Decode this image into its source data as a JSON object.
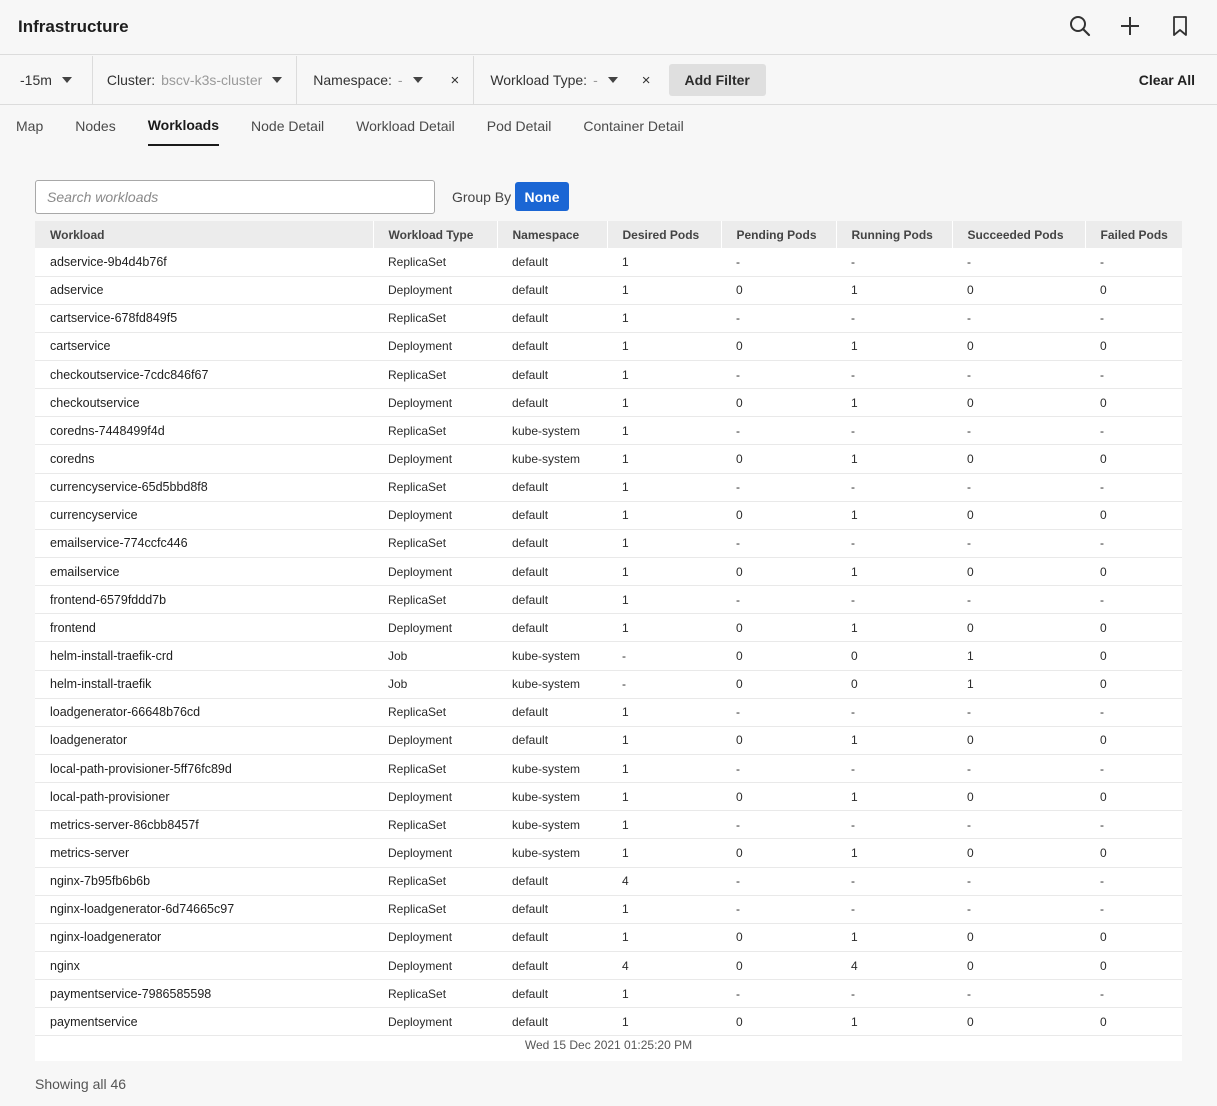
{
  "app": {
    "title": "Infrastructure"
  },
  "filters": {
    "time": "-15m",
    "cluster_label": "Cluster:",
    "cluster_value": "bscv-k3s-cluster",
    "namespace_label": "Namespace:",
    "namespace_value": "-",
    "workload_type_label": "Workload Type:",
    "workload_type_value": "-",
    "close_glyph": "×",
    "add_filter": "Add Filter",
    "clear_all": "Clear All"
  },
  "tabs": [
    {
      "label": "Map"
    },
    {
      "label": "Nodes"
    },
    {
      "label": "Workloads"
    },
    {
      "label": "Node Detail"
    },
    {
      "label": "Workload Detail"
    },
    {
      "label": "Pod Detail"
    },
    {
      "label": "Container Detail"
    }
  ],
  "search": {
    "placeholder": "Search workloads"
  },
  "group_by": {
    "label": "Group By",
    "value": "None"
  },
  "table": {
    "columns": [
      "Workload",
      "Workload Type",
      "Namespace",
      "Desired Pods",
      "Pending Pods",
      "Running Pods",
      "Succeeded Pods",
      "Failed Pods"
    ],
    "rows": [
      [
        "adservice-9b4d4b76f",
        "ReplicaSet",
        "default",
        "1",
        "-",
        "-",
        "-",
        "-"
      ],
      [
        "adservice",
        "Deployment",
        "default",
        "1",
        "0",
        "1",
        "0",
        "0"
      ],
      [
        "cartservice-678fd849f5",
        "ReplicaSet",
        "default",
        "1",
        "-",
        "-",
        "-",
        "-"
      ],
      [
        "cartservice",
        "Deployment",
        "default",
        "1",
        "0",
        "1",
        "0",
        "0"
      ],
      [
        "checkoutservice-7cdc846f67",
        "ReplicaSet",
        "default",
        "1",
        "-",
        "-",
        "-",
        "-"
      ],
      [
        "checkoutservice",
        "Deployment",
        "default",
        "1",
        "0",
        "1",
        "0",
        "0"
      ],
      [
        "coredns-7448499f4d",
        "ReplicaSet",
        "kube-system",
        "1",
        "-",
        "-",
        "-",
        "-"
      ],
      [
        "coredns",
        "Deployment",
        "kube-system",
        "1",
        "0",
        "1",
        "0",
        "0"
      ],
      [
        "currencyservice-65d5bbd8f8",
        "ReplicaSet",
        "default",
        "1",
        "-",
        "-",
        "-",
        "-"
      ],
      [
        "currencyservice",
        "Deployment",
        "default",
        "1",
        "0",
        "1",
        "0",
        "0"
      ],
      [
        "emailservice-774ccfc446",
        "ReplicaSet",
        "default",
        "1",
        "-",
        "-",
        "-",
        "-"
      ],
      [
        "emailservice",
        "Deployment",
        "default",
        "1",
        "0",
        "1",
        "0",
        "0"
      ],
      [
        "frontend-6579fddd7b",
        "ReplicaSet",
        "default",
        "1",
        "-",
        "-",
        "-",
        "-"
      ],
      [
        "frontend",
        "Deployment",
        "default",
        "1",
        "0",
        "1",
        "0",
        "0"
      ],
      [
        "helm-install-traefik-crd",
        "Job",
        "kube-system",
        "-",
        "0",
        "0",
        "1",
        "0"
      ],
      [
        "helm-install-traefik",
        "Job",
        "kube-system",
        "-",
        "0",
        "0",
        "1",
        "0"
      ],
      [
        "loadgenerator-66648b76cd",
        "ReplicaSet",
        "default",
        "1",
        "-",
        "-",
        "-",
        "-"
      ],
      [
        "loadgenerator",
        "Deployment",
        "default",
        "1",
        "0",
        "1",
        "0",
        "0"
      ],
      [
        "local-path-provisioner-5ff76fc89d",
        "ReplicaSet",
        "kube-system",
        "1",
        "-",
        "-",
        "-",
        "-"
      ],
      [
        "local-path-provisioner",
        "Deployment",
        "kube-system",
        "1",
        "0",
        "1",
        "0",
        "0"
      ],
      [
        "metrics-server-86cbb8457f",
        "ReplicaSet",
        "kube-system",
        "1",
        "-",
        "-",
        "-",
        "-"
      ],
      [
        "metrics-server",
        "Deployment",
        "kube-system",
        "1",
        "0",
        "1",
        "0",
        "0"
      ],
      [
        "nginx-7b95fb6b6b",
        "ReplicaSet",
        "default",
        "4",
        "-",
        "-",
        "-",
        "-"
      ],
      [
        "nginx-loadgenerator-6d74665c97",
        "ReplicaSet",
        "default",
        "1",
        "-",
        "-",
        "-",
        "-"
      ],
      [
        "nginx-loadgenerator",
        "Deployment",
        "default",
        "1",
        "0",
        "1",
        "0",
        "0"
      ],
      [
        "nginx",
        "Deployment",
        "default",
        "4",
        "0",
        "4",
        "0",
        "0"
      ],
      [
        "paymentservice-7986585598",
        "ReplicaSet",
        "default",
        "1",
        "-",
        "-",
        "-",
        "-"
      ],
      [
        "paymentservice",
        "Deployment",
        "default",
        "1",
        "0",
        "1",
        "0",
        "0"
      ]
    ],
    "timestamp": "Wed 15 Dec 2021 01:25:20 PM"
  },
  "footer": {
    "showing": "Showing all 46"
  },
  "colors": {
    "accent": "#1b66d4"
  },
  "icons": [
    "search-icon",
    "plus-icon",
    "bookmark-icon",
    "caret-down-icon",
    "close-icon"
  ]
}
